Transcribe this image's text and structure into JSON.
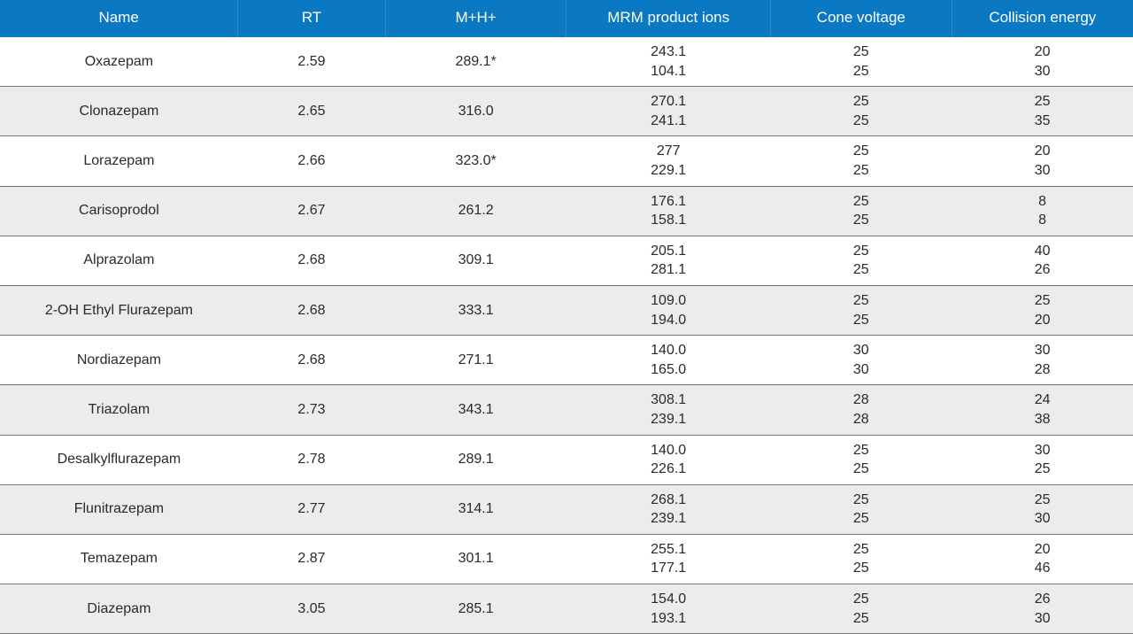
{
  "columns": [
    {
      "key": "name",
      "label": "Name"
    },
    {
      "key": "rt",
      "label": "RT"
    },
    {
      "key": "mh",
      "label": "M+H+"
    },
    {
      "key": "mrm",
      "label": "MRM product ions"
    },
    {
      "key": "cone",
      "label": "Cone voltage"
    },
    {
      "key": "ce",
      "label": "Collision energy"
    }
  ],
  "rows": [
    {
      "name": "Oxazepam",
      "rt": "2.59",
      "mh": "289.1*",
      "mrm": [
        "243.1",
        "104.1"
      ],
      "cone": [
        "25",
        "25"
      ],
      "ce": [
        "20",
        "30"
      ]
    },
    {
      "name": "Clonazepam",
      "rt": "2.65",
      "mh": "316.0",
      "mrm": [
        "270.1",
        "241.1"
      ],
      "cone": [
        "25",
        "25"
      ],
      "ce": [
        "25",
        "35"
      ]
    },
    {
      "name": "Lorazepam",
      "rt": "2.66",
      "mh": "323.0*",
      "mrm": [
        "277",
        "229.1"
      ],
      "cone": [
        "25",
        "25"
      ],
      "ce": [
        "20",
        "30"
      ]
    },
    {
      "name": "Carisoprodol",
      "rt": "2.67",
      "mh": "261.2",
      "mrm": [
        "176.1",
        "158.1"
      ],
      "cone": [
        "25",
        "25"
      ],
      "ce": [
        "8",
        "8"
      ]
    },
    {
      "name": "Alprazolam",
      "rt": "2.68",
      "mh": "309.1",
      "mrm": [
        "205.1",
        "281.1"
      ],
      "cone": [
        "25",
        "25"
      ],
      "ce": [
        "40",
        "26"
      ]
    },
    {
      "name": "2-OH Ethyl Flurazepam",
      "rt": "2.68",
      "mh": "333.1",
      "mrm": [
        "109.0",
        "194.0"
      ],
      "cone": [
        "25",
        "25"
      ],
      "ce": [
        "25",
        "20"
      ]
    },
    {
      "name": "Nordiazepam",
      "rt": "2.68",
      "mh": "271.1",
      "mrm": [
        "140.0",
        "165.0"
      ],
      "cone": [
        "30",
        "30"
      ],
      "ce": [
        "30",
        "28"
      ]
    },
    {
      "name": "Triazolam",
      "rt": "2.73",
      "mh": "343.1",
      "mrm": [
        "308.1",
        "239.1"
      ],
      "cone": [
        "28",
        "28"
      ],
      "ce": [
        "24",
        "38"
      ]
    },
    {
      "name": "Desalkylflurazepam",
      "rt": "2.78",
      "mh": "289.1",
      "mrm": [
        "140.0",
        "226.1"
      ],
      "cone": [
        "25",
        "25"
      ],
      "ce": [
        "30",
        "25"
      ]
    },
    {
      "name": "Flunitrazepam",
      "rt": "2.77",
      "mh": "314.1",
      "mrm": [
        "268.1",
        "239.1"
      ],
      "cone": [
        "25",
        "25"
      ],
      "ce": [
        "25",
        "30"
      ]
    },
    {
      "name": "Temazepam",
      "rt": "2.87",
      "mh": "301.1",
      "mrm": [
        "255.1",
        "177.1"
      ],
      "cone": [
        "25",
        "25"
      ],
      "ce": [
        "20",
        "46"
      ]
    },
    {
      "name": "Diazepam",
      "rt": "3.05",
      "mh": "285.1",
      "mrm": [
        "154.0",
        "193.1"
      ],
      "cone": [
        "25",
        "25"
      ],
      "ce": [
        "26",
        "30"
      ]
    }
  ]
}
